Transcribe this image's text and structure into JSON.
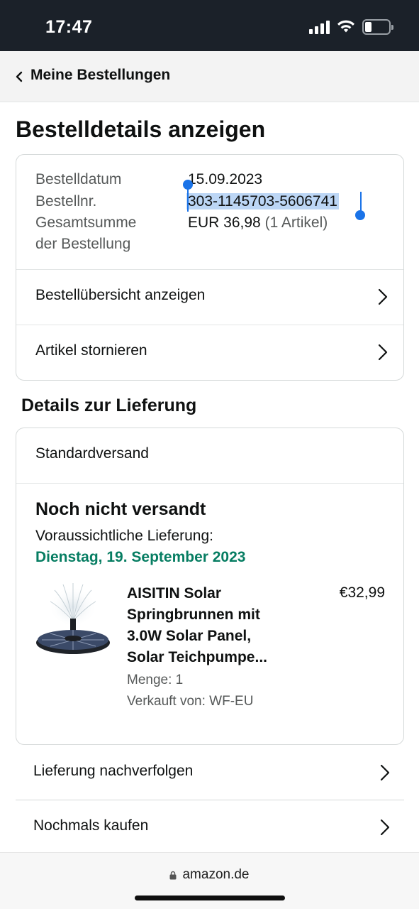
{
  "status_bar": {
    "time": "17:47"
  },
  "header": {
    "back_label": "Meine Bestellungen"
  },
  "page_title": "Bestelldetails anzeigen",
  "order": {
    "date_label": "Bestelldatum",
    "date_value": "15.09.2023",
    "number_label": "Bestellnr.",
    "number_value": "303-1145703-5606741",
    "total_label_line1": "Gesamtsumme",
    "total_label_line2": "der Bestellung",
    "total_value": "EUR 36,98",
    "total_items": "(1 Artikel)",
    "rows": [
      {
        "label": "Bestellübersicht anzeigen"
      },
      {
        "label": "Artikel stornieren"
      }
    ]
  },
  "delivery": {
    "section_title": "Details zur Lieferung",
    "shipping_method": "Standardversand",
    "status": "Noch nicht versandt",
    "eta_label": "Voraussichtliche Lieferung:",
    "eta_date": "Dienstag, 19. September 2023",
    "date_color": "#067d62",
    "product": {
      "title_lines": [
        "AISITIN Solar",
        "Springbrunnen mit",
        "3.0W Solar Panel,",
        "Solar Teichpumpe..."
      ],
      "price": "€32,99",
      "quantity": "Menge: 1",
      "seller": "Verkauft von: WF-EU",
      "image_icon": "solar-fountain-image"
    }
  },
  "actions": [
    {
      "label": "Lieferung nachverfolgen"
    },
    {
      "label": "Nochmals kaufen"
    }
  ],
  "url_bar": {
    "domain": "amazon.de"
  },
  "colors": {
    "selection": "#bcd6f5",
    "selection_handle": "#1a73e8",
    "status_bar_bg": "#1b2129"
  }
}
